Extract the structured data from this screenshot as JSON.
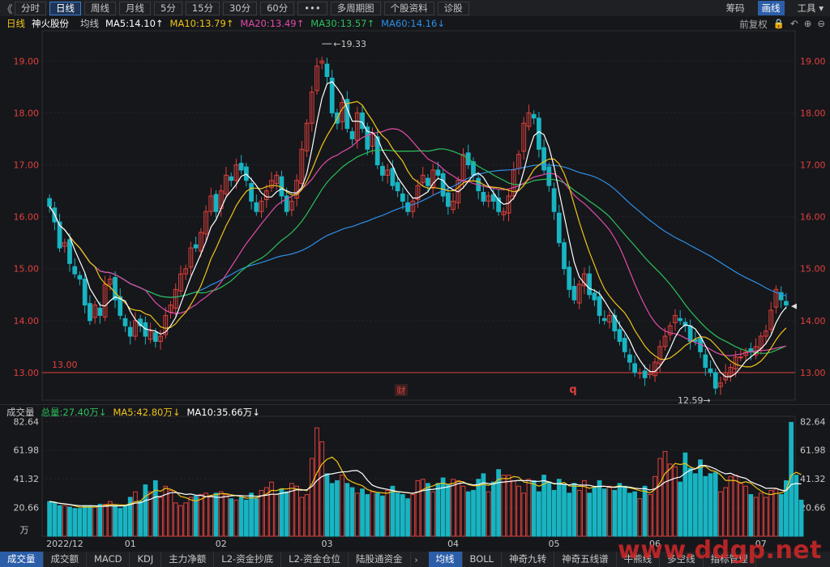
{
  "toolbar": {
    "back": "《",
    "tabs": [
      "分时",
      "日线",
      "周线",
      "月线",
      "5分",
      "15分",
      "30分",
      "60分",
      "•••",
      "多周期图",
      "个股资料",
      "诊股"
    ],
    "active_tab": 1,
    "right": [
      "筹码",
      "画线",
      "工具"
    ],
    "right_active": 1,
    "tools_arrow": "▾"
  },
  "info": {
    "period": "日线",
    "stock_name": "神火股份",
    "avg_label": "均线",
    "ma5": "MA5:14.10↑",
    "ma10": "MA10:13.79↑",
    "ma20": "MA20:13.49↑",
    "ma30": "MA30:13.57↑",
    "ma60": "MA60:14.16↓",
    "adjust": "前复权",
    "icons": [
      "lock-icon",
      "undo-icon",
      "zoom-in-icon",
      "zoom-out-icon"
    ]
  },
  "volume_info": {
    "title": "成交量",
    "total": "总量:27.40万↓",
    "ma5": "MA5:42.80万↓",
    "ma10": "MA10:35.66万↓"
  },
  "colors": {
    "up": "#e0403c",
    "down": "#19b4c2",
    "ma5": "#ffffff",
    "ma10": "#f0c418",
    "ma20": "#e04ca8",
    "ma30": "#2bc05a",
    "ma60": "#2d8fe8",
    "axis_text": "#e0403c"
  },
  "chart_data": {
    "type": "candlestick",
    "price_axis": {
      "ticks": [
        "19.00",
        "18.00",
        "17.00",
        "16.00",
        "15.00",
        "14.00",
        "13.00"
      ],
      "ylim": [
        12.5,
        19.55
      ]
    },
    "volume_axis": {
      "ticks": [
        "82.64",
        "61.98",
        "41.32",
        "20.66"
      ],
      "unit": "万",
      "ylim": [
        0,
        84
      ]
    },
    "x_labels": [
      "2022/12",
      "01",
      "02",
      "03",
      "04",
      "05",
      "06",
      "07"
    ],
    "x_label_index": [
      0,
      16,
      34,
      55,
      80,
      100,
      120,
      141
    ],
    "annotations": {
      "high": "19.33",
      "low": "12.59",
      "hline": "13.00",
      "marker_cai": "财",
      "marker_q": "q"
    },
    "close": [
      16.2,
      15.9,
      15.4,
      15.5,
      15.1,
      14.9,
      14.8,
      14.3,
      14.0,
      14.3,
      14.1,
      14.7,
      14.8,
      14.4,
      14.1,
      13.9,
      13.7,
      14.0,
      13.9,
      13.7,
      13.8,
      13.6,
      13.7,
      14.1,
      14.3,
      14.6,
      14.9,
      15.0,
      15.4,
      15.4,
      15.7,
      16.1,
      16.4,
      16.1,
      16.5,
      16.8,
      16.7,
      17.0,
      16.9,
      16.7,
      16.3,
      16.1,
      16.3,
      16.5,
      16.7,
      16.8,
      16.4,
      16.1,
      16.3,
      16.7,
      17.3,
      17.8,
      18.4,
      18.9,
      19.0,
      18.7,
      18.0,
      17.8,
      18.2,
      17.7,
      17.5,
      18.0,
      17.7,
      17.3,
      17.6,
      17.0,
      16.8,
      16.9,
      16.6,
      16.5,
      16.3,
      16.1,
      16.3,
      16.6,
      16.8,
      16.6,
      16.9,
      16.8,
      16.4,
      16.2,
      16.3,
      16.7,
      17.2,
      17.0,
      16.8,
      16.5,
      16.3,
      16.4,
      16.3,
      16.1,
      16.1,
      16.4,
      16.9,
      17.2,
      17.8,
      18.0,
      17.9,
      17.3,
      16.9,
      16.6,
      16.1,
      15.5,
      15.0,
      14.6,
      14.4,
      14.7,
      14.9,
      14.5,
      14.4,
      14.1,
      14.0,
      14.1,
      13.8,
      13.6,
      13.4,
      13.2,
      13.0,
      13.0,
      12.9,
      13.0,
      13.2,
      13.5,
      13.7,
      13.9,
      14.1,
      14.0,
      13.9,
      13.6,
      13.6,
      13.4,
      13.1,
      13.0,
      12.7,
      12.8,
      13.0,
      13.1,
      13.3,
      13.3,
      13.4,
      13.4,
      13.5,
      13.7,
      13.8,
      14.2,
      14.6,
      14.4,
      14.3
    ],
    "volume": [
      25,
      24,
      22,
      22,
      21,
      20,
      20,
      22,
      22,
      21,
      23,
      23,
      25,
      22,
      20,
      22,
      28,
      32,
      25,
      37,
      32,
      40,
      28,
      36,
      33,
      24,
      22,
      24,
      28,
      29,
      30,
      31,
      29,
      31,
      32,
      30,
      27,
      26,
      28,
      26,
      31,
      27,
      33,
      35,
      39,
      30,
      34,
      32,
      38,
      36,
      28,
      30,
      56,
      78,
      68,
      45,
      38,
      40,
      44,
      38,
      35,
      31,
      34,
      30,
      32,
      31,
      29,
      33,
      36,
      31,
      30,
      27,
      30,
      40,
      41,
      38,
      32,
      38,
      42,
      37,
      41,
      40,
      36,
      32,
      33,
      41,
      45,
      32,
      39,
      48,
      44,
      44,
      40,
      36,
      31,
      41,
      40,
      32,
      44,
      39,
      33,
      41,
      37,
      31,
      38,
      33,
      40,
      31,
      35,
      40,
      34,
      36,
      33,
      38,
      36,
      31,
      32,
      27,
      36,
      30,
      43,
      56,
      61,
      52,
      50,
      39,
      60,
      49,
      45,
      55,
      43,
      45,
      46,
      32,
      35,
      43,
      44,
      38,
      36,
      30,
      28,
      31,
      28,
      33,
      34,
      30,
      40,
      82,
      44,
      26
    ]
  }
}
